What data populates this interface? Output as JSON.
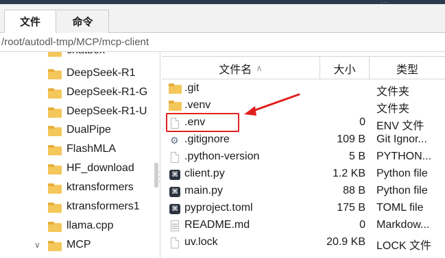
{
  "tabs": [
    {
      "label": "文件"
    },
    {
      "label": "命令"
    }
  ],
  "path": "/root/autodl-tmp/MCP/mcp-client",
  "tree": {
    "items": [
      {
        "label": "chatbox"
      },
      {
        "label": "DeepSeek-R1"
      },
      {
        "label": "DeepSeek-R1-G"
      },
      {
        "label": "DeepSeek-R1-U"
      },
      {
        "label": "DualPipe"
      },
      {
        "label": "FlashMLA"
      },
      {
        "label": "HF_download"
      },
      {
        "label": "ktransformers"
      },
      {
        "label": "ktransformers1"
      },
      {
        "label": "llama.cpp"
      },
      {
        "label": "MCP"
      }
    ]
  },
  "list": {
    "columns": {
      "name": "文件名",
      "size": "大小",
      "type": "类型"
    },
    "sort_indicator": "∧",
    "rows": [
      {
        "name": ".git",
        "size": "",
        "type": "文件夹",
        "icon": "folder-icon"
      },
      {
        "name": ".venv",
        "size": "",
        "type": "文件夹",
        "icon": "folder-icon"
      },
      {
        "name": ".env",
        "size": "0",
        "type": "ENV 文件",
        "icon": "file-icon"
      },
      {
        "name": ".gitignore",
        "size": "109 B",
        "type": "Git Ignor...",
        "icon": "gear-file-icon"
      },
      {
        "name": ".python-version",
        "size": "5 B",
        "type": "PYTHON...",
        "icon": "file-icon"
      },
      {
        "name": "client.py",
        "size": "1.2 KB",
        "type": "Python file",
        "icon": "python-file-icon"
      },
      {
        "name": "main.py",
        "size": "88 B",
        "type": "Python file",
        "icon": "python-file-icon"
      },
      {
        "name": "pyproject.toml",
        "size": "175 B",
        "type": "TOML file",
        "icon": "toml-file-icon"
      },
      {
        "name": "README.md",
        "size": "0",
        "type": "Markdow...",
        "icon": "doc-icon"
      },
      {
        "name": "uv.lock",
        "size": "20.9 KB",
        "type": "LOCK 文件",
        "icon": "file-icon"
      }
    ]
  },
  "annotation": {
    "highlight_color": "#e02020"
  }
}
